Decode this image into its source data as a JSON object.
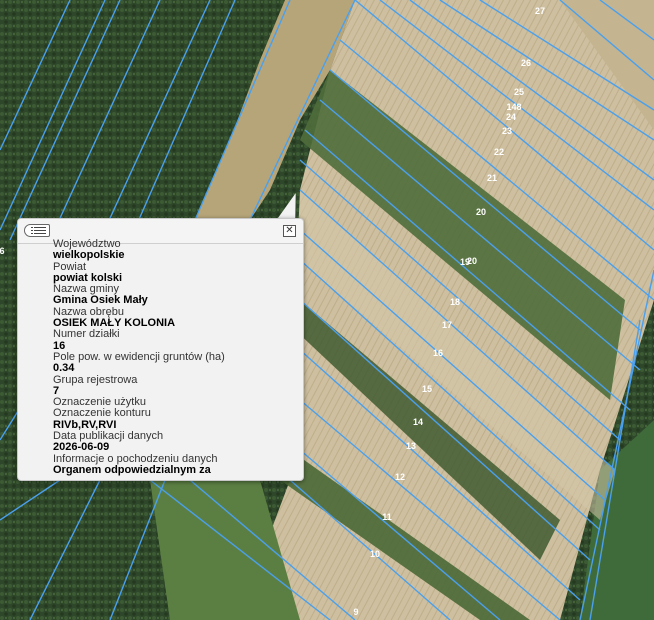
{
  "map": {
    "plot_labels": [
      "27",
      "26",
      "25",
      "148",
      "24",
      "23",
      "22",
      "21",
      "20",
      "19",
      "18",
      "17",
      "16",
      "15",
      "14",
      "13",
      "12",
      "11",
      "10",
      "9",
      "6",
      "20"
    ]
  },
  "popup": {
    "back_icon": "list-back-icon",
    "close_icon": "close-icon",
    "fields": [
      {
        "label": "Województwo",
        "value": "wielkopolskie"
      },
      {
        "label": "Powiat",
        "value": "powiat kolski"
      },
      {
        "label": "Nazwa gminy",
        "value": "Gmina Osiek Mały"
      },
      {
        "label": "Nazwa obrębu",
        "value": "OSIEK MAŁY KOLONIA"
      },
      {
        "label": "Numer działki",
        "value": "16"
      },
      {
        "label": "Pole pow. w ewidencji gruntów (ha)",
        "value": "0.34"
      },
      {
        "label": "Grupa rejestrowa",
        "value": "7"
      },
      {
        "label": "Oznaczenie użytku",
        "value": ""
      },
      {
        "label": "Oznaczenie konturu",
        "value": "RIVb,RV,RVI"
      },
      {
        "label": "Data publikacji danych",
        "value": "2026-06-09"
      },
      {
        "label": "Informacje o pochodzeniu danych",
        "value": "Organem odpowiedzialnym za"
      }
    ]
  },
  "colors": {
    "forest": "#2f4a2a",
    "field_light": "#c9bb98",
    "field_green": "#4d6b3a",
    "parcel_line": "#4aa0ee",
    "popup_bg": "#f2f2f2"
  }
}
